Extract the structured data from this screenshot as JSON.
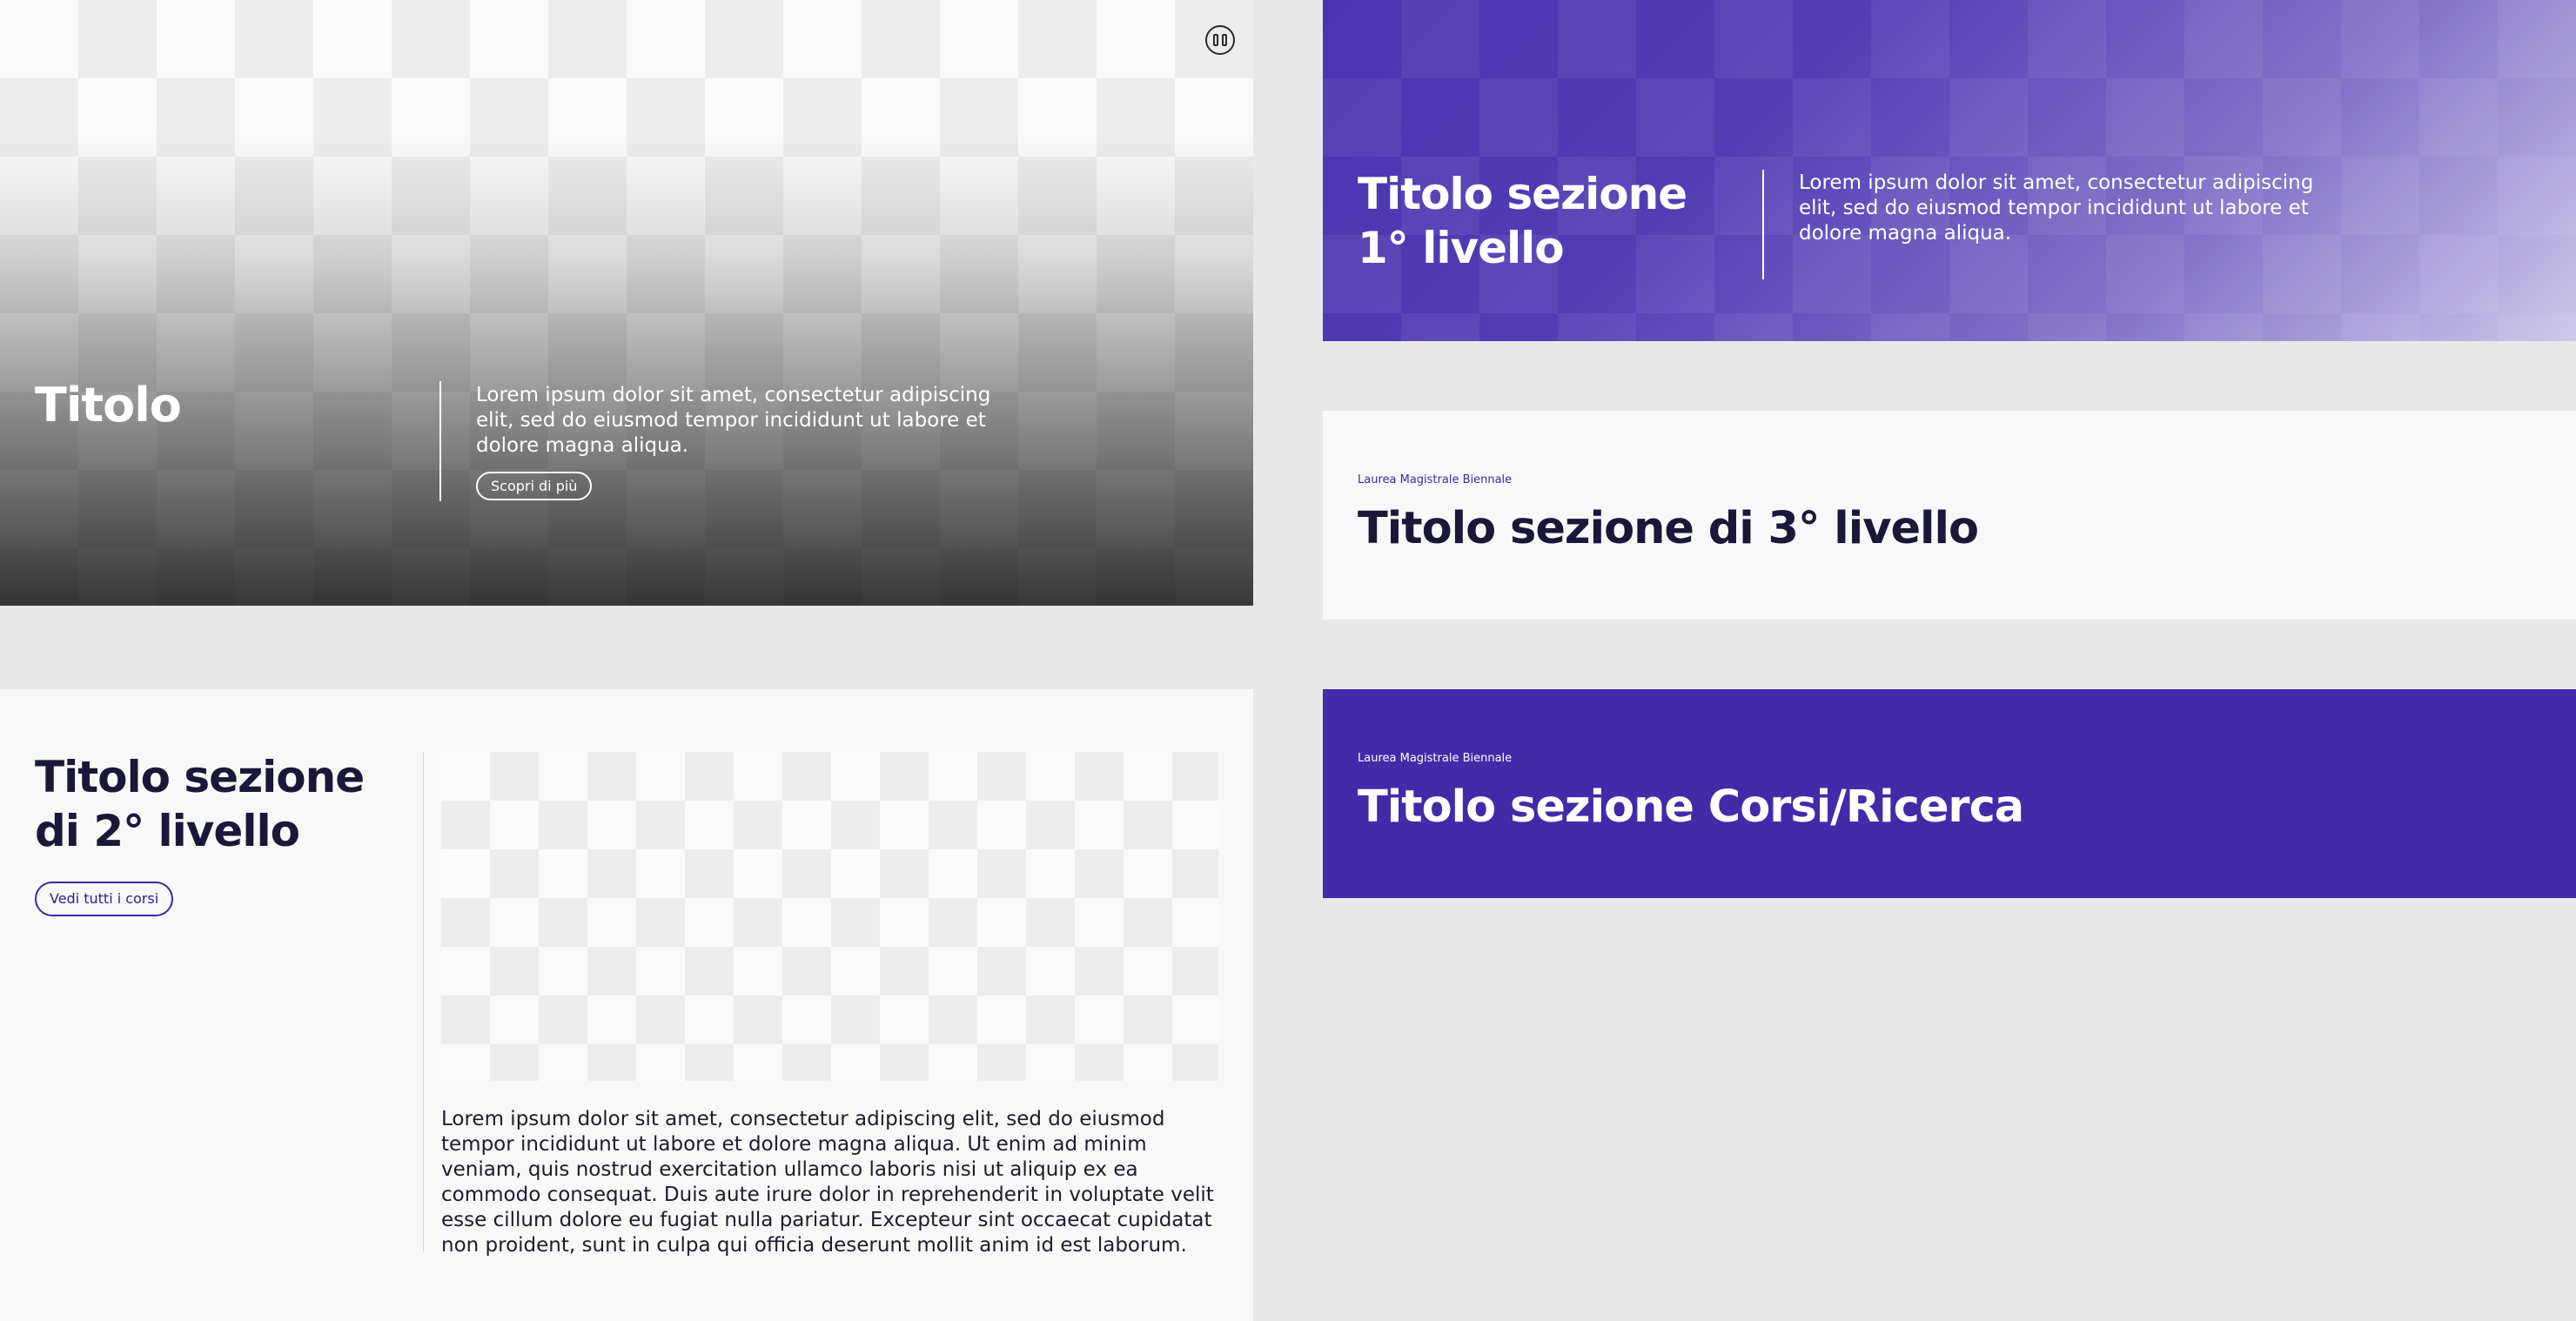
{
  "hero": {
    "title": "Titolo",
    "text": "Lorem ipsum dolor sit amet, consectetur adipiscing elit, sed do eiusmod tempor incididunt ut labore et dolore magna aliqua.",
    "button_label": "Scopri di più",
    "pause_icon": "pause-icon"
  },
  "section_1": {
    "title": "Titolo sezione 1° livello",
    "text": "Lorem ipsum dolor sit amet, consectetur adipiscing elit, sed do eiusmod tempor incididunt ut labore et dolore magna aliqua.",
    "background_color": "#4a33b0"
  },
  "section_2": {
    "title": "Titolo sezione di 2° livello",
    "button_label": "Vedi tutti i corsi",
    "text": "Lorem ipsum dolor sit amet, consectetur adipiscing elit, sed do eiusmod tempor incididunt ut labore et dolore magna aliqua. Ut enim ad minim veniam, quis nostrud exercitation ullamco laboris nisi ut aliquip ex ea commodo consequat. Duis aute irure dolor in reprehenderit in voluptate velit esse cillum dolore eu fugiat nulla pariatur. Excepteur sint occaecat cupidatat non proident, sunt in culpa qui officia deserunt mollit anim id est laborum."
  },
  "section_3": {
    "eyebrow": "Laurea Magistrale Biennale",
    "title": "Titolo sezione di 3° livello"
  },
  "section_corsi": {
    "eyebrow": "Laurea Magistrale Biennale",
    "title": "Titolo sezione Corsi/Ricerca",
    "background_color": "#422aa9"
  },
  "colors": {
    "page_background": "#e8e8e8",
    "panel_light": "#f8f8f8",
    "brand_purple": "#422aa9",
    "dark_text": "#1a1838"
  }
}
